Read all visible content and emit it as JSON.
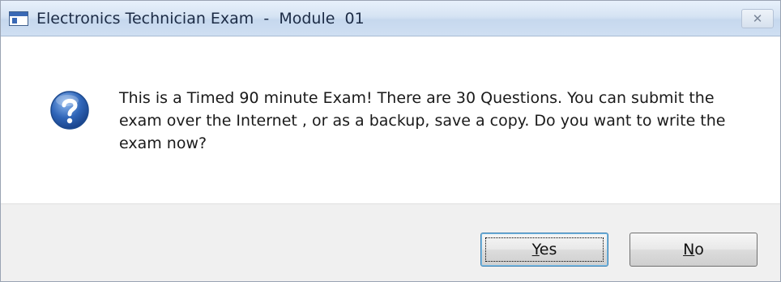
{
  "window": {
    "title": "Electronics Technician Exam  -  Module  01",
    "close_glyph": "✕"
  },
  "message": {
    "icon": "question-icon",
    "text": "This is a Timed 90 minute Exam! There are 30 Questions.  You can submit the exam over the Internet , or as a backup, save a copy.  Do you want to write the exam now?"
  },
  "buttons": {
    "yes": {
      "accel": "Y",
      "rest": "es"
    },
    "no": {
      "accel": "N",
      "rest": "o"
    }
  },
  "colors": {
    "accent": "#2f65b8",
    "titlebar": "#d5e3f3",
    "button_bar": "#f0f0f0"
  }
}
